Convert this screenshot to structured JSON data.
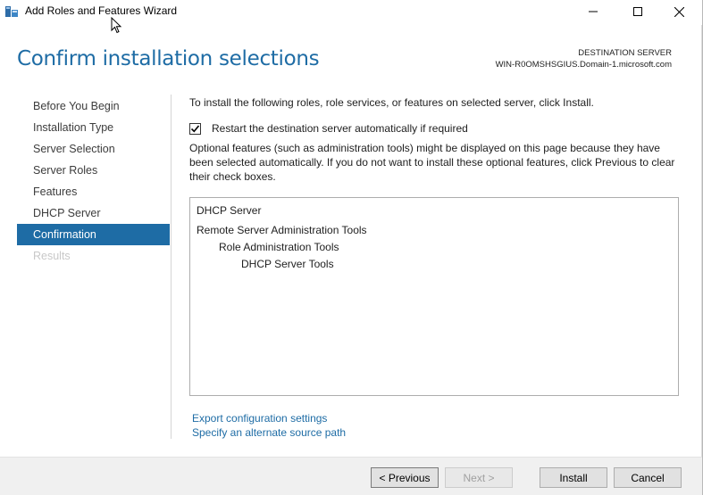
{
  "window": {
    "title": "Add Roles and Features Wizard",
    "controls": {
      "minimize_icon": "minimize-icon",
      "maximize_icon": "maximize-icon",
      "close_icon": "close-icon"
    }
  },
  "header": {
    "page_title": "Confirm installation selections",
    "destination_label": "DESTINATION SERVER",
    "destination_server": "WIN-R0OMSHSGIUS.Domain-1.microsoft.com"
  },
  "nav": {
    "items": [
      {
        "label": "Before You Begin",
        "state": "normal"
      },
      {
        "label": "Installation Type",
        "state": "normal"
      },
      {
        "label": "Server Selection",
        "state": "normal"
      },
      {
        "label": "Server Roles",
        "state": "normal"
      },
      {
        "label": "Features",
        "state": "normal"
      },
      {
        "label": "DHCP Server",
        "state": "normal"
      },
      {
        "label": "Confirmation",
        "state": "active"
      },
      {
        "label": "Results",
        "state": "disabled"
      }
    ]
  },
  "content": {
    "intro": "To install the following roles, role services, or features on selected server, click Install.",
    "restart_checkbox": {
      "label": "Restart the destination server automatically if required",
      "checked": true
    },
    "optional_text": "Optional features (such as administration tools) might be displayed on this page because they have been selected automatically. If you do not want to install these optional features, click Previous to clear their check boxes.",
    "features": [
      {
        "label": "DHCP Server",
        "level": 0
      },
      {
        "label": "Remote Server Administration Tools",
        "level": 0
      },
      {
        "label": "Role Administration Tools",
        "level": 1
      },
      {
        "label": "DHCP Server Tools",
        "level": 2
      }
    ],
    "links": {
      "export": "Export configuration settings",
      "alternate_source": "Specify an alternate source path"
    }
  },
  "footer": {
    "previous": "< Previous",
    "next": "Next >",
    "install": "Install",
    "cancel": "Cancel"
  },
  "colors": {
    "accent": "#1e6ca5",
    "footer_bg": "#f0f0f0"
  }
}
